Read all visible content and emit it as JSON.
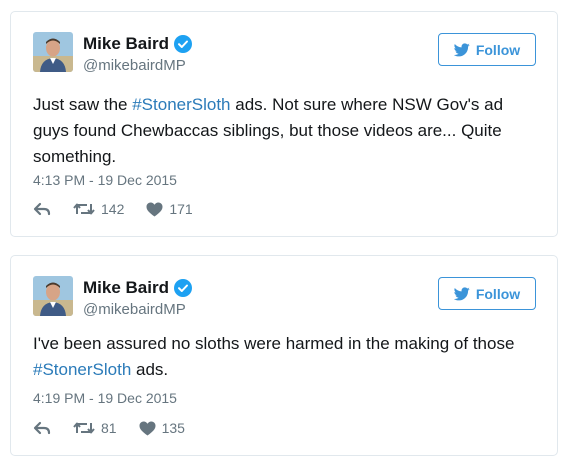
{
  "tweets": [
    {
      "name": "Mike Baird",
      "handle": "@mikebairdMP",
      "follow_label": "Follow",
      "text_before": "Just saw the ",
      "hashtag": "#StonerSloth",
      "text_after": " ads. Not sure where NSW Gov's ad guys found Chewbaccas siblings, but those videos are... Quite something.",
      "timestamp": "4:13 PM - 19 Dec 2015",
      "retweets": "142",
      "likes": "171"
    },
    {
      "name": "Mike Baird",
      "handle": "@mikebairdMP",
      "follow_label": "Follow",
      "text_before": "I've been assured no sloths were harmed in the making of those ",
      "hashtag": "#StonerSloth",
      "text_after": " ads.",
      "timestamp": "4:19 PM - 19 Dec 2015",
      "retweets": "81",
      "likes": "135"
    }
  ],
  "icons": {
    "verified": "verified-badge-icon",
    "bird": "twitter-bird-icon",
    "reply": "reply-icon",
    "retweet": "retweet-icon",
    "like": "heart-icon"
  },
  "colors": {
    "brand_blue": "#3b94d9",
    "hashtag": "#2b7bb9",
    "muted": "#66757f",
    "border": "#e1e8ed"
  }
}
